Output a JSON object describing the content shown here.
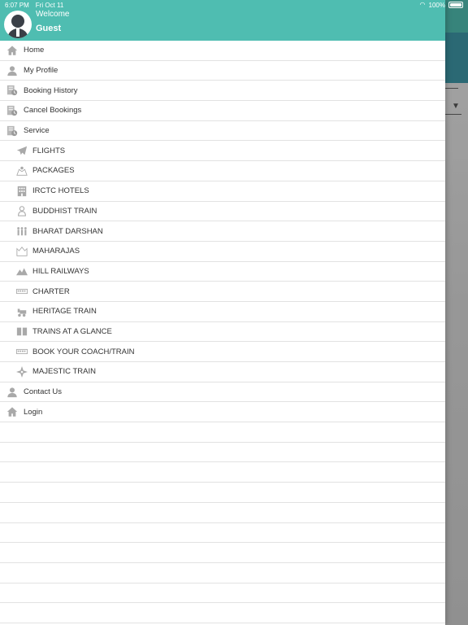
{
  "status_bar": {
    "time": "6:07 PM",
    "date": "Fri Oct 11",
    "battery": "100%"
  },
  "drawer": {
    "welcome": "Welcome",
    "user": "Guest"
  },
  "menu": [
    {
      "label": "Home",
      "icon": "home-icon",
      "level": "top"
    },
    {
      "label": "My Profile",
      "icon": "user-icon",
      "level": "top"
    },
    {
      "label": "Booking History",
      "icon": "document-clock-icon",
      "level": "top"
    },
    {
      "label": "Cancel Bookings",
      "icon": "document-clock-icon",
      "level": "top"
    },
    {
      "label": "Service",
      "icon": "document-clock-icon",
      "level": "top"
    },
    {
      "label": "FLIGHTS",
      "icon": "airplane-icon",
      "level": "sub"
    },
    {
      "label": "PACKAGES",
      "icon": "map-pin-icon",
      "level": "sub"
    },
    {
      "label": "IRCTC HOTELS",
      "icon": "building-icon",
      "level": "sub"
    },
    {
      "label": "BUDDHIST TRAIN",
      "icon": "buddha-icon",
      "level": "sub"
    },
    {
      "label": "BHARAT DARSHAN",
      "icon": "people-icon",
      "level": "sub"
    },
    {
      "label": "MAHARAJAS",
      "icon": "palace-icon",
      "level": "sub"
    },
    {
      "label": "HILL RAILWAYS",
      "icon": "mountain-icon",
      "level": "sub"
    },
    {
      "label": "CHARTER",
      "icon": "coach-icon",
      "level": "sub"
    },
    {
      "label": "HERITAGE TRAIN",
      "icon": "steam-engine-icon",
      "level": "sub"
    },
    {
      "label": "TRAINS AT A GLANCE",
      "icon": "book-icon",
      "level": "sub"
    },
    {
      "label": "BOOK YOUR COACH/TRAIN",
      "icon": "coach-icon",
      "level": "sub"
    },
    {
      "label": "MAJESTIC TRAIN",
      "icon": "compass-icon",
      "level": "sub"
    },
    {
      "label": "Contact Us",
      "icon": "user-icon",
      "level": "top"
    },
    {
      "label": "Login",
      "icon": "home-icon",
      "level": "top"
    }
  ],
  "colors": {
    "header": "#4fbdb1",
    "icon": "#a9a9a9",
    "text": "#333333",
    "divider": "#e2e2e2"
  }
}
